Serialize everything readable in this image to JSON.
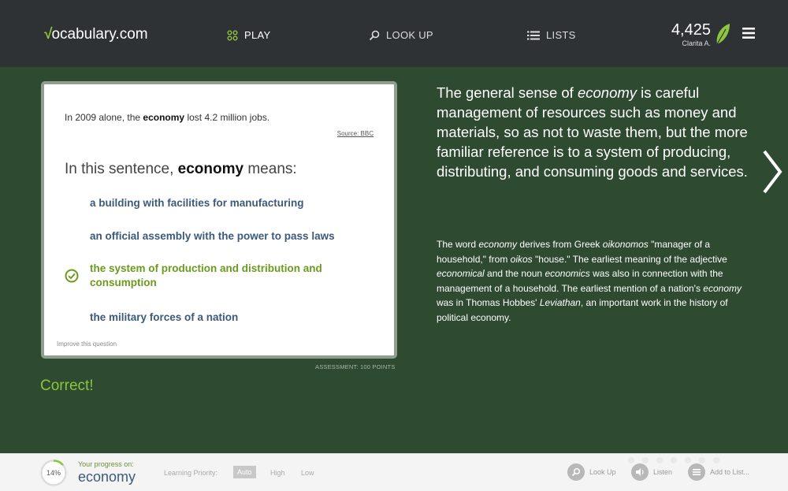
{
  "nav": {
    "logo_mark": "√",
    "logo_text": "ocabulary.com",
    "play": "PLAY",
    "lookup": "LOOK UP",
    "lists": "LISTS",
    "points": "4,425",
    "user": "Clarita A."
  },
  "question": {
    "sentence_before": "In 2009 alone, the ",
    "sentence_word": "economy",
    "sentence_after": " lost 4.2 million jobs.",
    "source": "Source: BBC",
    "prompt_before": "In this sentence, ",
    "prompt_word": "economy",
    "prompt_after": " means:",
    "options": [
      "a building with facilities for manufacturing",
      "an official assembly with the power to pass laws",
      "the system of production and distribution and consumption",
      "the military forces of a nation"
    ],
    "improve": "Improve this question",
    "assessment": "ASSESSMENT: 100 POINTS",
    "result": "Correct!"
  },
  "explanation": {
    "def_1": "The general sense of ",
    "def_2": "economy",
    "def_3": " is careful management of resources such as money and materials, so as not to waste them, but the more familiar reference is to a system of producing, distributing, and consuming goods and services.",
    "ety_1": "The word ",
    "ety_2": "economy",
    "ety_3": " derives from Greek ",
    "ety_4": "oikonomos",
    "ety_5": " \"manager of a household,\" from ",
    "ety_6": "oikos",
    "ety_7": " \"house.\" The earliest meaning of the adjective ",
    "ety_8": "economical",
    "ety_9": " and the noun ",
    "ety_10": "economics",
    "ety_11": " was also in connection with the management of a household. The earliest mention of a nation's ",
    "ety_12": "economy",
    "ety_13": " was in Thomas Hobbes' ",
    "ety_14": "Leviathan",
    "ety_15": ", an important work in the history of political economy."
  },
  "footer": {
    "progress_pct": "14%",
    "progress_value": 0.14,
    "progress_label": "Your progress on:",
    "progress_word": "economy",
    "priority_label": "Learning Priority:",
    "priority_auto": "Auto",
    "priority_high": "High",
    "priority_low": "Low",
    "look_up": "Look Up",
    "listen": "Listen",
    "add_to_list": "Add to List..."
  },
  "colors": {
    "nav_bg": "#2e3235",
    "main_bg": "#2e4a31",
    "accent_green": "#8cc63e",
    "option_blue": "#3c5a7a"
  }
}
